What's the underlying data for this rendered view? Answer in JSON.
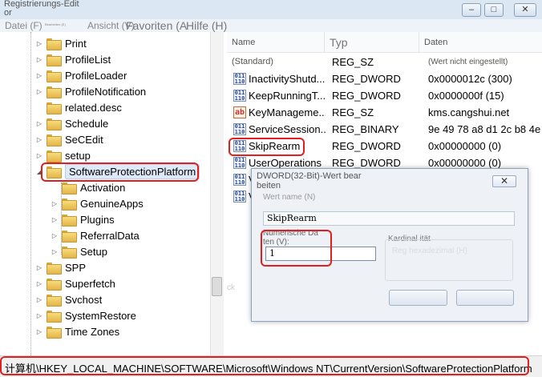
{
  "window": {
    "title_line1": "Registrierungs-Edit",
    "title_line2": "or",
    "minimize": "–",
    "maximize": "□",
    "close": "✕"
  },
  "menu": {
    "file": "Datei (F)",
    "edit": "Bearbeiten (E)",
    "view": "Ansicht (V)",
    "favorites": "Favoriten (A",
    "help": "Hilfe (H)"
  },
  "tree": {
    "items": [
      {
        "label": "Print",
        "expander": "▷"
      },
      {
        "label": "ProfileList",
        "expander": "▷"
      },
      {
        "label": "ProfileLoader",
        "expander": "▷"
      },
      {
        "label": "ProfileNotification",
        "expander": "▷"
      },
      {
        "label": "related.desc",
        "expander": ""
      },
      {
        "label": "Schedule",
        "expander": "▷"
      },
      {
        "label": "SeCEdit",
        "expander": "▷"
      },
      {
        "label": "setup",
        "expander": "▷"
      },
      {
        "label": "SoftwareProtectionPlatform",
        "expander": "◢"
      },
      {
        "label": "Activation",
        "expander": ""
      },
      {
        "label": "GenuineApps",
        "expander": "▷"
      },
      {
        "label": "Plugins",
        "expander": "▷"
      },
      {
        "label": "ReferralData",
        "expander": "▷"
      },
      {
        "label": "Setup",
        "expander": "▷"
      },
      {
        "label": "SPP",
        "expander": "▷"
      },
      {
        "label": "Superfetch",
        "expander": "▷"
      },
      {
        "label": "Svchost",
        "expander": "▷"
      },
      {
        "label": "SystemRestore",
        "expander": "▷"
      },
      {
        "label": "Time Zones",
        "expander": "▷"
      }
    ]
  },
  "list": {
    "headers": {
      "name": "Name",
      "type": "Typ",
      "data": "Daten"
    },
    "rows": [
      {
        "name": "(Standard)",
        "type": "REG_SZ",
        "data": "(Wert nicht eingestellt)",
        "icon": ""
      },
      {
        "name": "InactivityShutd...",
        "type": "REG_DWORD",
        "data": "0x0000012c (300)",
        "icon": "binary-value-icon"
      },
      {
        "name": "KeepRunningT...",
        "type": "REG_DWORD",
        "data": "0x0000000f (15)",
        "icon": "binary-value-icon"
      },
      {
        "name": "KeyManageme...",
        "type": "REG_SZ",
        "data": "kms.cangshui.net",
        "icon": "string-value-icon"
      },
      {
        "name": "ServiceSession...",
        "type": "REG_BINARY",
        "data": "9e 49 78 a8 d1 2c b8 4e",
        "icon": "binary-value-icon"
      },
      {
        "name": "SkipRearm",
        "type": "REG_DWORD",
        "data": "0x00000000 (0)",
        "icon": "binary-value-icon"
      },
      {
        "name": "UserOperations",
        "type": "REG_DWORD",
        "data": "0x00000000 (0)",
        "icon": "binary-value-icon"
      },
      {
        "name": "V",
        "type": "",
        "data": "",
        "icon": "binary-value-icon"
      },
      {
        "name": "V",
        "type": "",
        "data": "",
        "icon": "binary-value-icon"
      }
    ],
    "icon_text": {
      "binary": "011\n110",
      "string": "ab"
    }
  },
  "dialog": {
    "title_line1": "DWORD(32-Bit)-Wert bear",
    "title_line2": "beiten",
    "close": "✕",
    "value_name_label": "Wert name (N)",
    "value_name": "SkipRearm",
    "value_data_label_line1": "Numerische Da",
    "value_data_label_line2": "ten (V):",
    "value_data": "1",
    "base_label": "Kardinal ität",
    "base_option": "Reg hexadezimal (H)",
    "ghost_text": "ck"
  },
  "status": {
    "path": "计算机\\HKEY_LOCAL_MACHINE\\SOFTWARE\\Microsoft\\Windows NT\\CurrentVersion\\SoftwareProtectionPlatform"
  },
  "colors": {
    "highlight": "#e02020",
    "selection": "#dde9f7",
    "folder": "#f0c85a"
  }
}
